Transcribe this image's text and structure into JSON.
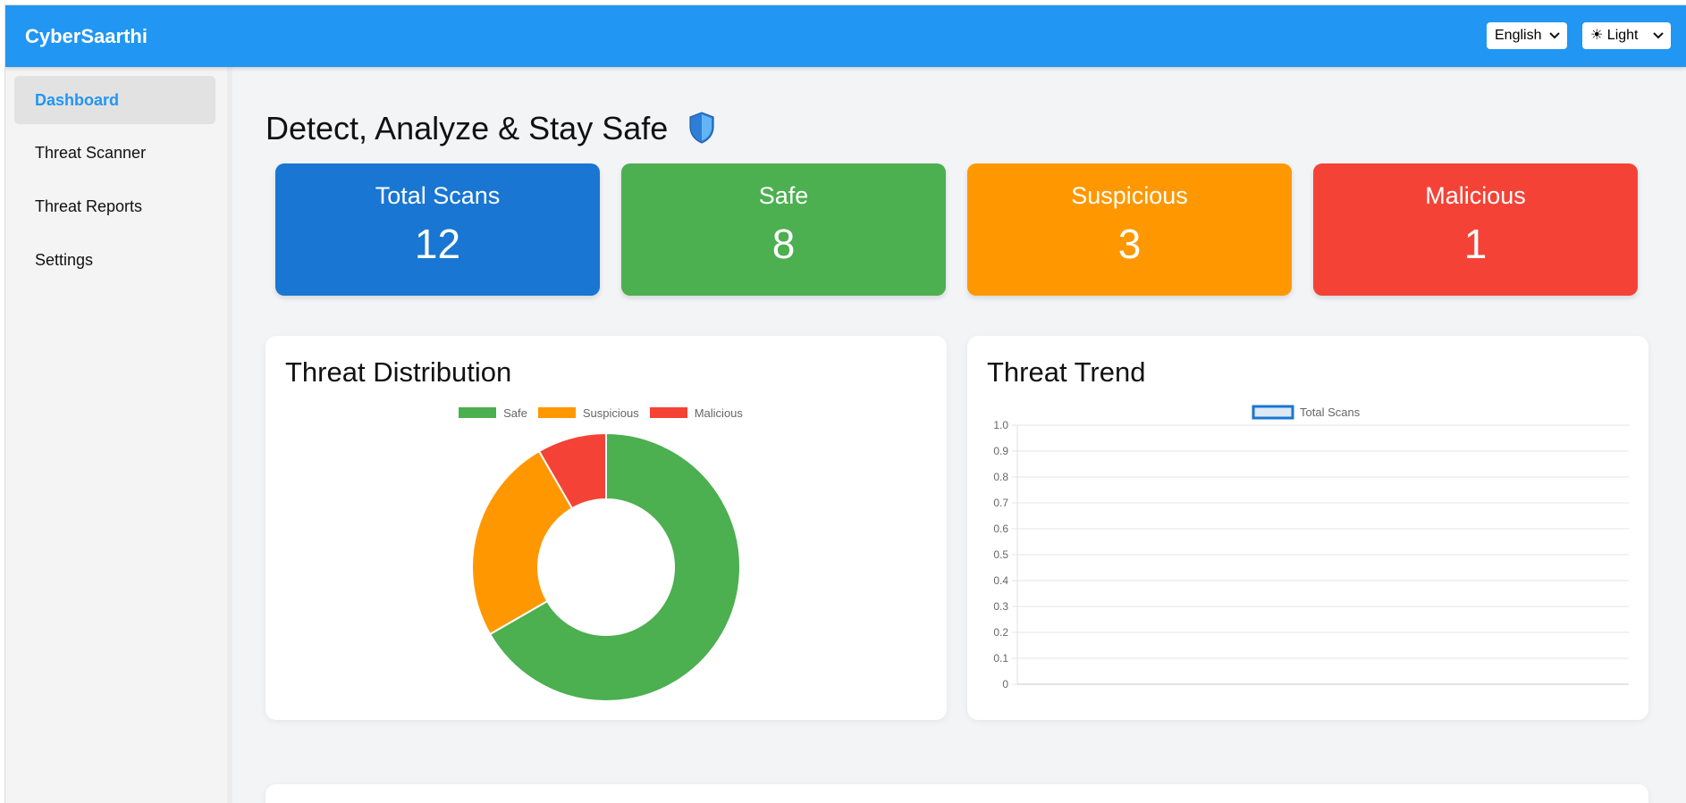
{
  "app": {
    "title": "CyberSaarthi"
  },
  "header": {
    "language": "English",
    "theme": "☀ Light"
  },
  "sidebar": {
    "items": [
      {
        "label": "Dashboard",
        "active": true
      },
      {
        "label": "Threat Scanner",
        "active": false
      },
      {
        "label": "Threat Reports",
        "active": false
      },
      {
        "label": "Settings",
        "active": false
      }
    ]
  },
  "main": {
    "headline": "Detect, Analyze & Stay Safe",
    "stats": [
      {
        "label": "Total Scans",
        "value": "12",
        "color": "#1976d2"
      },
      {
        "label": "Safe",
        "value": "8",
        "color": "#4caf50"
      },
      {
        "label": "Suspicious",
        "value": "3",
        "color": "#ff9800"
      },
      {
        "label": "Malicious",
        "value": "1",
        "color": "#f44336"
      }
    ],
    "distribution_card": {
      "title": "Threat Distribution"
    },
    "trend_card": {
      "title": "Threat Trend"
    }
  },
  "chart_data": [
    {
      "type": "pie",
      "donut": true,
      "title": "Threat Distribution",
      "categories": [
        "Safe",
        "Suspicious",
        "Malicious"
      ],
      "values": [
        8,
        3,
        1
      ],
      "colors": [
        "#4caf50",
        "#ff9800",
        "#f44336"
      ],
      "legend": "top"
    },
    {
      "type": "line",
      "title": "Threat Trend",
      "series": [
        {
          "name": "Total Scans",
          "values": [],
          "color": "#1976d2"
        }
      ],
      "x": [],
      "ylim": [
        0,
        1
      ],
      "yticks": [
        "0",
        "0.1",
        "0.2",
        "0.3",
        "0.4",
        "0.5",
        "0.6",
        "0.7",
        "0.8",
        "0.9",
        "1.0"
      ],
      "grid": true,
      "legend": "top"
    }
  ]
}
